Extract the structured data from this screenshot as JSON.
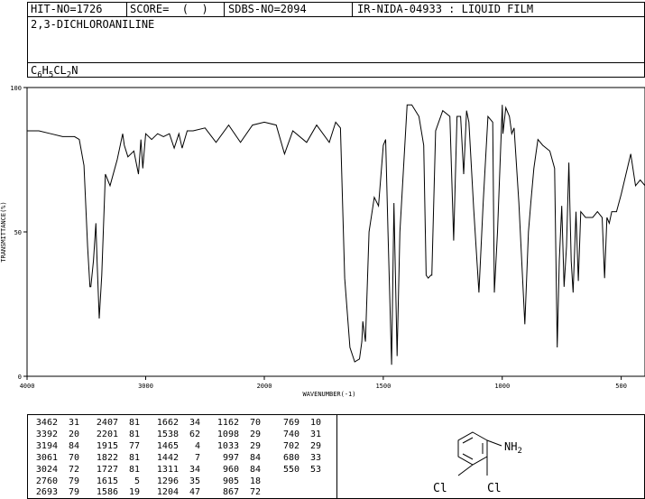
{
  "header": {
    "hit_no": "HIT-NO=1726",
    "score": "SCORE=  (  )",
    "sdbs_no": "SDBS-NO=2094",
    "ir_id": "IR-NIDA-04933 : LIQUID FILM"
  },
  "compound": {
    "name": "2,3-DICHLOROANILINE",
    "formula_parts": [
      "C",
      "6",
      "H",
      "5",
      "CL",
      "2",
      "N"
    ]
  },
  "chart_data": {
    "type": "line",
    "xlabel": "WAVENUMBER(-1)",
    "ylabel": "TRANSMITTANCE(%)",
    "xlim": [
      4000,
      400
    ],
    "ylim": [
      0,
      100
    ],
    "x_ticks": [
      4000,
      3000,
      2000,
      1500,
      1000,
      500
    ],
    "y_ticks": [
      0,
      50,
      100
    ],
    "series": [
      {
        "x": [
          4000,
          3900,
          3800,
          3700,
          3600,
          3560,
          3520,
          3490,
          3470,
          3462,
          3440,
          3420,
          3410,
          3392,
          3370,
          3340,
          3300,
          3240,
          3194,
          3180,
          3150,
          3100,
          3061,
          3040,
          3024,
          3000,
          2950,
          2900,
          2850,
          2800,
          2760,
          2720,
          2693,
          2650,
          2600,
          2500,
          2407,
          2300,
          2201,
          2100,
          2000,
          1950,
          1915,
          1880,
          1822,
          1780,
          1727,
          1700,
          1680,
          1662,
          1640,
          1620,
          1600,
          1590,
          1586,
          1575,
          1560,
          1538,
          1520,
          1500,
          1490,
          1480,
          1465,
          1455,
          1442,
          1430,
          1400,
          1380,
          1350,
          1330,
          1320,
          1311,
          1300,
          1296,
          1280,
          1250,
          1220,
          1204,
          1190,
          1175,
          1162,
          1150,
          1140,
          1120,
          1098,
          1080,
          1060,
          1040,
          1033,
          1020,
          1000,
          997,
          985,
          970,
          960,
          950,
          930,
          905,
          890,
          880,
          867,
          850,
          830,
          800,
          780,
          769,
          760,
          750,
          740,
          730,
          720,
          710,
          702,
          690,
          680,
          670,
          650,
          620,
          600,
          580,
          570,
          560,
          550,
          540,
          520,
          500,
          480,
          460,
          440,
          420,
          400
        ],
        "y": [
          85,
          85,
          84,
          83,
          83,
          82,
          73,
          45,
          31,
          31,
          40,
          53,
          40,
          20,
          35,
          70,
          66,
          75,
          84,
          80,
          76,
          78,
          70,
          82,
          72,
          84,
          82,
          84,
          83,
          84,
          79,
          84,
          79,
          85,
          85,
          86,
          81,
          87,
          81,
          87,
          88,
          87,
          77,
          85,
          81,
          87,
          81,
          88,
          86,
          34,
          10,
          5,
          6,
          12,
          19,
          12,
          50,
          62,
          59,
          80,
          82,
          50,
          4,
          60,
          7,
          50,
          94,
          94,
          90,
          80,
          35,
          34,
          35,
          35,
          85,
          92,
          90,
          47,
          90,
          90,
          70,
          92,
          88,
          58,
          29,
          60,
          90,
          88,
          29,
          50,
          94,
          84,
          93,
          90,
          84,
          86,
          60,
          18,
          50,
          60,
          72,
          82,
          80,
          78,
          72,
          10,
          40,
          59,
          31,
          45,
          74,
          40,
          29,
          57,
          33,
          57,
          55,
          55,
          57,
          55,
          34,
          55,
          53,
          57,
          57,
          63,
          70,
          77,
          66,
          68,
          66
        ]
      }
    ]
  },
  "peak_table": {
    "columns": [
      [
        [
          "3462",
          "31"
        ],
        [
          "3392",
          "20"
        ],
        [
          "3194",
          "84"
        ],
        [
          "3061",
          "70"
        ],
        [
          "3024",
          "72"
        ],
        [
          "2760",
          "79"
        ],
        [
          "2693",
          "79"
        ]
      ],
      [
        [
          "2407",
          "81"
        ],
        [
          "2201",
          "81"
        ],
        [
          "1915",
          "77"
        ],
        [
          "1822",
          "81"
        ],
        [
          "1727",
          "81"
        ],
        [
          "1615",
          "5"
        ],
        [
          "1586",
          "19"
        ]
      ],
      [
        [
          "1662",
          "34"
        ],
        [
          "1538",
          "62"
        ],
        [
          "1465",
          "4"
        ],
        [
          "1442",
          "7"
        ],
        [
          "1311",
          "34"
        ],
        [
          "1296",
          "35"
        ],
        [
          "1204",
          "47"
        ]
      ],
      [
        [
          "1162",
          "70"
        ],
        [
          "1098",
          "29"
        ],
        [
          "1033",
          "29"
        ],
        [
          "997",
          "84"
        ],
        [
          "960",
          "84"
        ],
        [
          "905",
          "18"
        ],
        [
          "867",
          "72"
        ]
      ],
      [
        [
          "769",
          "10"
        ],
        [
          "740",
          "31"
        ],
        [
          "702",
          "29"
        ],
        [
          "680",
          "33"
        ],
        [
          "550",
          "53"
        ]
      ]
    ]
  },
  "structure": {
    "substituent_nh2": [
      "NH",
      "2"
    ],
    "substituent_cl_left": "Cl",
    "substituent_cl_right": "Cl"
  }
}
